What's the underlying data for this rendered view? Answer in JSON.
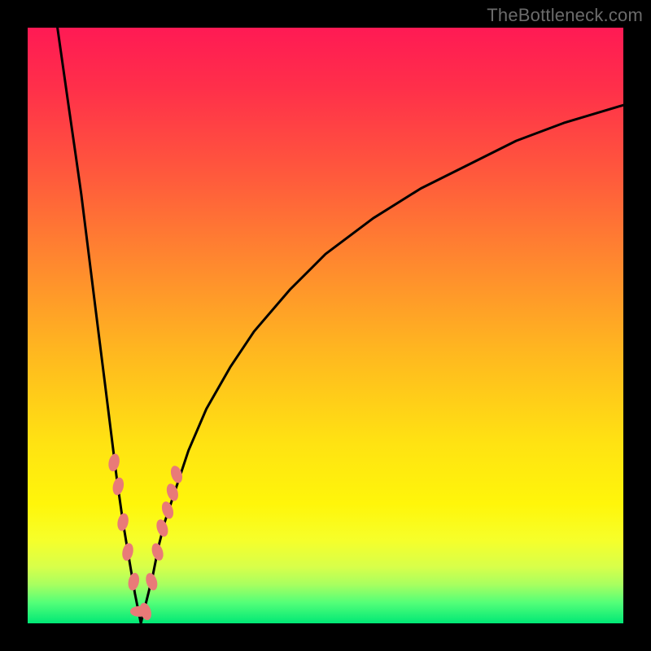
{
  "watermark": "TheBottleneck.com",
  "colors": {
    "frame": "#000000",
    "gradient_stops": [
      {
        "offset": 0.0,
        "color": "#ff1a54"
      },
      {
        "offset": 0.1,
        "color": "#ff2f4a"
      },
      {
        "offset": 0.25,
        "color": "#ff5a3c"
      },
      {
        "offset": 0.4,
        "color": "#ff8a2e"
      },
      {
        "offset": 0.55,
        "color": "#ffb91f"
      },
      {
        "offset": 0.7,
        "color": "#ffe312"
      },
      {
        "offset": 0.8,
        "color": "#fff60a"
      },
      {
        "offset": 0.86,
        "color": "#f6ff2a"
      },
      {
        "offset": 0.905,
        "color": "#d8ff4a"
      },
      {
        "offset": 0.935,
        "color": "#a8ff60"
      },
      {
        "offset": 0.965,
        "color": "#54ff78"
      },
      {
        "offset": 1.0,
        "color": "#00e876"
      }
    ],
    "curve": "#000000",
    "marker_fill": "#e97a78",
    "marker_stroke": "#c95552"
  },
  "chart_data": {
    "type": "line",
    "title": "",
    "xlabel": "",
    "ylabel": "",
    "xlim": [
      0,
      100
    ],
    "ylim": [
      0,
      100
    ],
    "grid": false,
    "legend": false,
    "min_x": 19,
    "series": [
      {
        "name": "bottleneck-curve",
        "x": [
          5,
          6,
          7,
          8,
          9,
          10,
          11,
          12,
          13,
          14,
          15,
          16,
          17,
          18,
          19,
          20,
          21,
          22,
          23,
          24,
          25,
          27,
          30,
          34,
          38,
          44,
          50,
          58,
          66,
          74,
          82,
          90,
          100
        ],
        "y": [
          100,
          93,
          86,
          79,
          72,
          64,
          56,
          48,
          40,
          32,
          24,
          17,
          11,
          5,
          0,
          4,
          8,
          13,
          17,
          20,
          23,
          29,
          36,
          43,
          49,
          56,
          62,
          68,
          73,
          77,
          81,
          84,
          87
        ]
      }
    ],
    "markers": {
      "name": "highlighted-points",
      "x": [
        14.5,
        15.2,
        16.0,
        16.8,
        17.8,
        18.7,
        19.8,
        20.8,
        21.8,
        22.6,
        23.5,
        24.3,
        25.0
      ],
      "y": [
        27,
        23,
        17,
        12,
        7,
        2,
        2,
        7,
        12,
        16,
        19,
        22,
        25
      ]
    }
  }
}
